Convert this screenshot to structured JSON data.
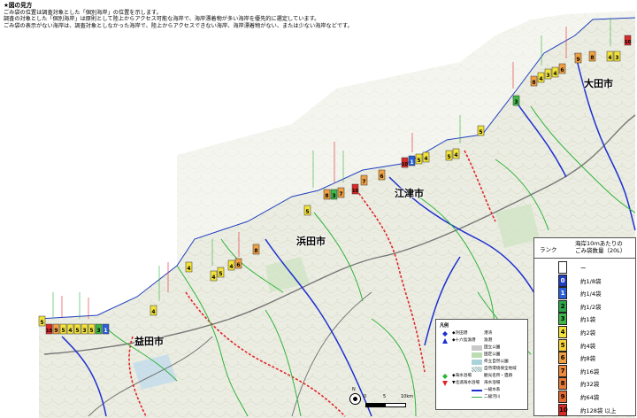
{
  "notes": {
    "heading": "★図の見方",
    "line1": "ごみ袋の位置は調査対象とした「個別海岸」の位置を示します。",
    "line2": "調査の対象とした「個別海岸」は原則として陸上からアクセス可能な海岸で、海岸漂着物が多い海岸を優先的に選定しています。",
    "line3": "ごみ袋の表示がない海岸は、調査対象としなかった海岸で、陸上からアクセスできない海岸、海岸漂着物がない、または少ない海岸などです。"
  },
  "cities": {
    "oda": "大田市",
    "gotsu": "江津市",
    "hamada": "浜田市",
    "masuda": "益田市"
  },
  "rank_legend": {
    "col_rank": "ランク",
    "col_amount_l1": "海岸10ｍあたりの",
    "col_amount_l2": "ごみ袋数量（20L）",
    "rows": [
      {
        "rank": "",
        "label": "ー",
        "color": "#ffffff"
      },
      {
        "rank": "0",
        "label": "約1/8袋",
        "color": "#1f3dbf"
      },
      {
        "rank": "1",
        "label": "約1/4袋",
        "color": "#2b5fd9"
      },
      {
        "rank": "2",
        "label": "約1/2袋",
        "color": "#2aa84a"
      },
      {
        "rank": "3",
        "label": "約1袋",
        "color": "#3cb846"
      },
      {
        "rank": "4",
        "label": "約2袋",
        "color": "#f2e23a"
      },
      {
        "rank": "5",
        "label": "約4袋",
        "color": "#f6d23a"
      },
      {
        "rank": "6",
        "label": "約8袋",
        "color": "#f0a040"
      },
      {
        "rank": "7",
        "label": "約16袋",
        "color": "#ee8a3a"
      },
      {
        "rank": "8",
        "label": "約32袋",
        "color": "#e97c36"
      },
      {
        "rank": "9",
        "label": "約64袋",
        "color": "#e36a32"
      },
      {
        "rank": "10",
        "label": "約128袋 以上",
        "color": "#d92a2a"
      }
    ]
  },
  "map_legend": {
    "title": "凡例",
    "rows": [
      {
        "label": "◆浜田港",
        "desc": "港湾",
        "symbol": "blue-diamond"
      },
      {
        "label": "◆十六島漁港",
        "desc": "漁港",
        "symbol": "blue-triangle"
      },
      {
        "label": "",
        "desc": "国立公園",
        "symbol": "grey-fill"
      },
      {
        "label": "",
        "desc": "国定公園",
        "symbol": "green-fill"
      },
      {
        "label": "",
        "desc": "県立自然公園",
        "symbol": "teal-fill"
      },
      {
        "label": "",
        "desc": "自然環境保全地域",
        "symbol": "hatch"
      },
      {
        "label": "◆海水浴場",
        "desc": "観光名所・遺跡",
        "symbol": "green-diamond"
      },
      {
        "label": "▼北浦海水浴場",
        "desc": "海水浴場",
        "symbol": "red-triangle"
      },
      {
        "label": "",
        "desc": "一級水系",
        "symbol": "blue-line"
      },
      {
        "label": "",
        "desc": "二級河川",
        "symbol": "green-line"
      }
    ]
  },
  "scale": {
    "north": "N",
    "t0": "0",
    "t5": "5",
    "t10": "10km"
  },
  "colors": {
    "sea": "#ffffff",
    "land": "#eeefe6",
    "river": "#1c2fd0",
    "stream": "#2fb33b",
    "boundary": "#e0262b",
    "road": "#6a6a6a"
  }
}
